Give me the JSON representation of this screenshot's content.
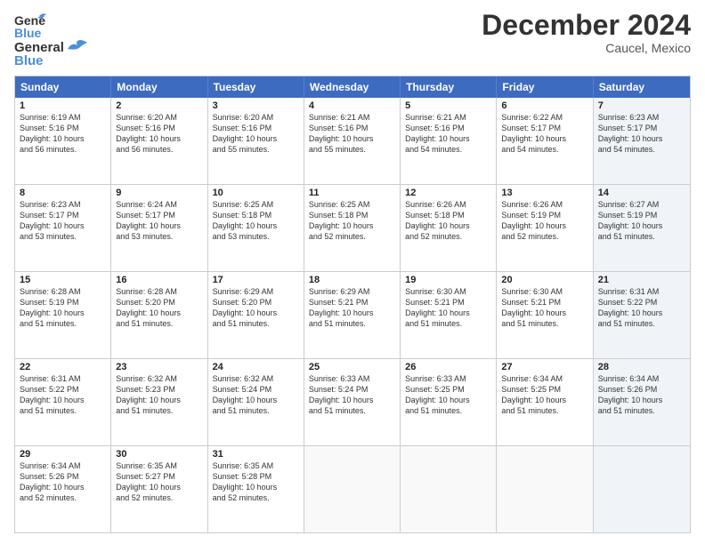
{
  "logo": {
    "line1": "General",
    "line2": "Blue"
  },
  "title": "December 2024",
  "location": "Caucel, Mexico",
  "weekdays": [
    "Sunday",
    "Monday",
    "Tuesday",
    "Wednesday",
    "Thursday",
    "Friday",
    "Saturday"
  ],
  "rows": [
    [
      {
        "day": "1",
        "text": "Sunrise: 6:19 AM\nSunset: 5:16 PM\nDaylight: 10 hours\nand 56 minutes.",
        "shaded": false
      },
      {
        "day": "2",
        "text": "Sunrise: 6:20 AM\nSunset: 5:16 PM\nDaylight: 10 hours\nand 56 minutes.",
        "shaded": false
      },
      {
        "day": "3",
        "text": "Sunrise: 6:20 AM\nSunset: 5:16 PM\nDaylight: 10 hours\nand 55 minutes.",
        "shaded": false
      },
      {
        "day": "4",
        "text": "Sunrise: 6:21 AM\nSunset: 5:16 PM\nDaylight: 10 hours\nand 55 minutes.",
        "shaded": false
      },
      {
        "day": "5",
        "text": "Sunrise: 6:21 AM\nSunset: 5:16 PM\nDaylight: 10 hours\nand 54 minutes.",
        "shaded": false
      },
      {
        "day": "6",
        "text": "Sunrise: 6:22 AM\nSunset: 5:17 PM\nDaylight: 10 hours\nand 54 minutes.",
        "shaded": false
      },
      {
        "day": "7",
        "text": "Sunrise: 6:23 AM\nSunset: 5:17 PM\nDaylight: 10 hours\nand 54 minutes.",
        "shaded": true
      }
    ],
    [
      {
        "day": "8",
        "text": "Sunrise: 6:23 AM\nSunset: 5:17 PM\nDaylight: 10 hours\nand 53 minutes.",
        "shaded": false
      },
      {
        "day": "9",
        "text": "Sunrise: 6:24 AM\nSunset: 5:17 PM\nDaylight: 10 hours\nand 53 minutes.",
        "shaded": false
      },
      {
        "day": "10",
        "text": "Sunrise: 6:25 AM\nSunset: 5:18 PM\nDaylight: 10 hours\nand 53 minutes.",
        "shaded": false
      },
      {
        "day": "11",
        "text": "Sunrise: 6:25 AM\nSunset: 5:18 PM\nDaylight: 10 hours\nand 52 minutes.",
        "shaded": false
      },
      {
        "day": "12",
        "text": "Sunrise: 6:26 AM\nSunset: 5:18 PM\nDaylight: 10 hours\nand 52 minutes.",
        "shaded": false
      },
      {
        "day": "13",
        "text": "Sunrise: 6:26 AM\nSunset: 5:19 PM\nDaylight: 10 hours\nand 52 minutes.",
        "shaded": false
      },
      {
        "day": "14",
        "text": "Sunrise: 6:27 AM\nSunset: 5:19 PM\nDaylight: 10 hours\nand 51 minutes.",
        "shaded": true
      }
    ],
    [
      {
        "day": "15",
        "text": "Sunrise: 6:28 AM\nSunset: 5:19 PM\nDaylight: 10 hours\nand 51 minutes.",
        "shaded": false
      },
      {
        "day": "16",
        "text": "Sunrise: 6:28 AM\nSunset: 5:20 PM\nDaylight: 10 hours\nand 51 minutes.",
        "shaded": false
      },
      {
        "day": "17",
        "text": "Sunrise: 6:29 AM\nSunset: 5:20 PM\nDaylight: 10 hours\nand 51 minutes.",
        "shaded": false
      },
      {
        "day": "18",
        "text": "Sunrise: 6:29 AM\nSunset: 5:21 PM\nDaylight: 10 hours\nand 51 minutes.",
        "shaded": false
      },
      {
        "day": "19",
        "text": "Sunrise: 6:30 AM\nSunset: 5:21 PM\nDaylight: 10 hours\nand 51 minutes.",
        "shaded": false
      },
      {
        "day": "20",
        "text": "Sunrise: 6:30 AM\nSunset: 5:21 PM\nDaylight: 10 hours\nand 51 minutes.",
        "shaded": false
      },
      {
        "day": "21",
        "text": "Sunrise: 6:31 AM\nSunset: 5:22 PM\nDaylight: 10 hours\nand 51 minutes.",
        "shaded": true
      }
    ],
    [
      {
        "day": "22",
        "text": "Sunrise: 6:31 AM\nSunset: 5:22 PM\nDaylight: 10 hours\nand 51 minutes.",
        "shaded": false
      },
      {
        "day": "23",
        "text": "Sunrise: 6:32 AM\nSunset: 5:23 PM\nDaylight: 10 hours\nand 51 minutes.",
        "shaded": false
      },
      {
        "day": "24",
        "text": "Sunrise: 6:32 AM\nSunset: 5:24 PM\nDaylight: 10 hours\nand 51 minutes.",
        "shaded": false
      },
      {
        "day": "25",
        "text": "Sunrise: 6:33 AM\nSunset: 5:24 PM\nDaylight: 10 hours\nand 51 minutes.",
        "shaded": false
      },
      {
        "day": "26",
        "text": "Sunrise: 6:33 AM\nSunset: 5:25 PM\nDaylight: 10 hours\nand 51 minutes.",
        "shaded": false
      },
      {
        "day": "27",
        "text": "Sunrise: 6:34 AM\nSunset: 5:25 PM\nDaylight: 10 hours\nand 51 minutes.",
        "shaded": false
      },
      {
        "day": "28",
        "text": "Sunrise: 6:34 AM\nSunset: 5:26 PM\nDaylight: 10 hours\nand 51 minutes.",
        "shaded": true
      }
    ],
    [
      {
        "day": "29",
        "text": "Sunrise: 6:34 AM\nSunset: 5:26 PM\nDaylight: 10 hours\nand 52 minutes.",
        "shaded": false
      },
      {
        "day": "30",
        "text": "Sunrise: 6:35 AM\nSunset: 5:27 PM\nDaylight: 10 hours\nand 52 minutes.",
        "shaded": false
      },
      {
        "day": "31",
        "text": "Sunrise: 6:35 AM\nSunset: 5:28 PM\nDaylight: 10 hours\nand 52 minutes.",
        "shaded": false
      },
      {
        "day": "",
        "text": "",
        "shaded": false,
        "empty": true
      },
      {
        "day": "",
        "text": "",
        "shaded": false,
        "empty": true
      },
      {
        "day": "",
        "text": "",
        "shaded": false,
        "empty": true
      },
      {
        "day": "",
        "text": "",
        "shaded": true,
        "empty": true
      }
    ]
  ]
}
